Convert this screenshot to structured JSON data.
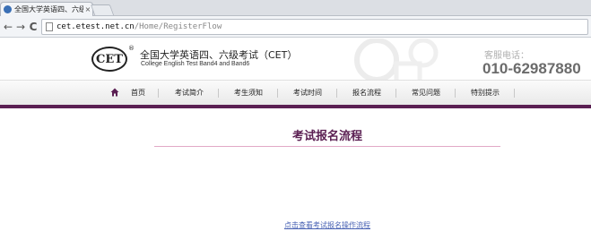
{
  "browser": {
    "tab_title": "全国大学英语四、六级考试",
    "tab_close": "×",
    "back_glyph": "←",
    "forward_glyph": "→",
    "reload_glyph": "C",
    "url_host": "cet.etest.net.cn",
    "url_path": "/Home/RegisterFlow"
  },
  "header": {
    "logo_text": "CET",
    "registered_mark": "®",
    "title_cn": "全国大学英语四、六级考试（CET）",
    "title_en": "College English Test Band4 and Band6",
    "hotline_label": "客服电话：",
    "hotline_number": "010-62987880"
  },
  "nav": {
    "items": [
      {
        "label": "首页"
      },
      {
        "label": "考试简介"
      },
      {
        "label": "考生须知"
      },
      {
        "label": "考试时间"
      },
      {
        "label": "报名流程"
      },
      {
        "label": "常见问题"
      },
      {
        "label": "特别提示"
      }
    ]
  },
  "content": {
    "title": "考试报名流程",
    "flow_link": "点击查看考试报名操作流程"
  },
  "colors": {
    "brand_purple": "#5a1f52",
    "link_blue": "#4a63b4"
  }
}
